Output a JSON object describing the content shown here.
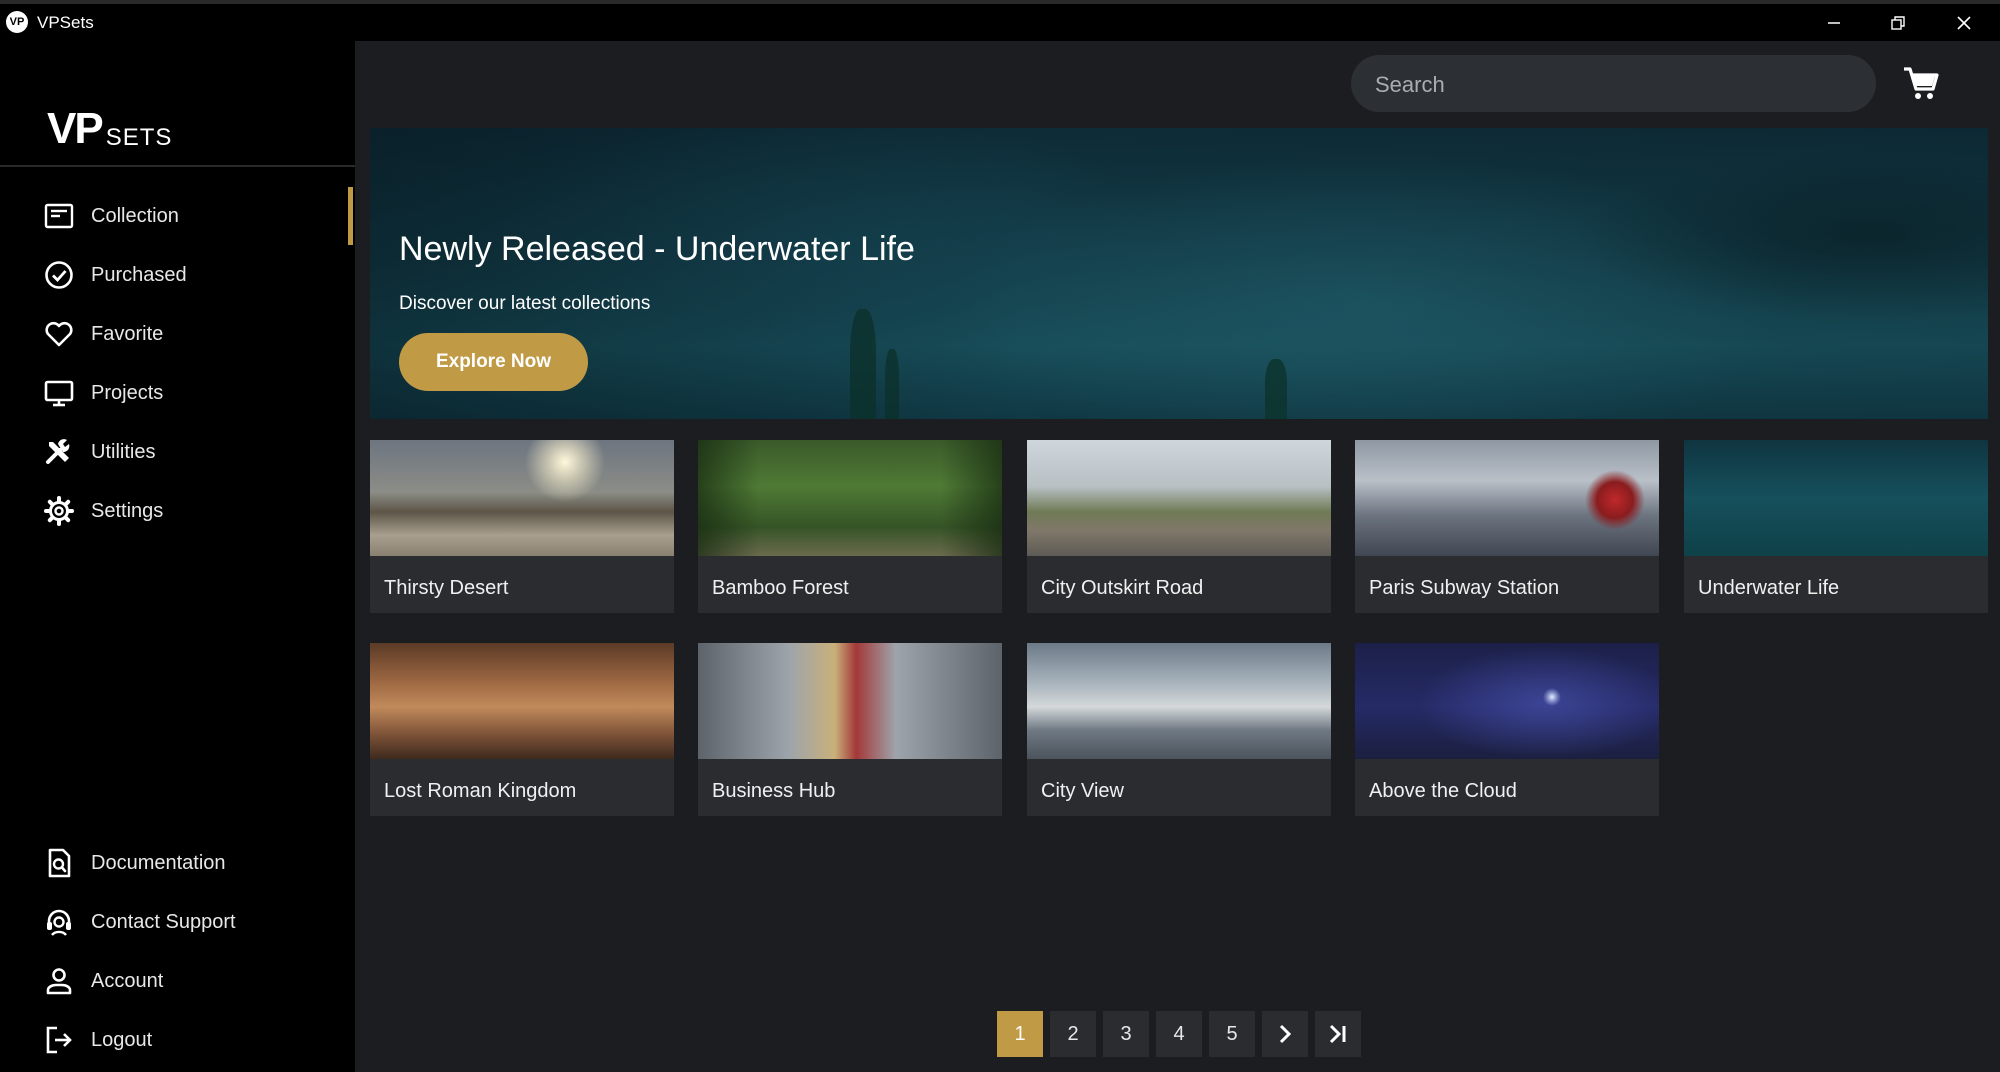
{
  "window": {
    "title": "VPSets",
    "app_icon": "VP",
    "controls": [
      "minimize-icon",
      "restore-icon",
      "close-icon"
    ]
  },
  "logo": {
    "primary": "VP",
    "secondary": "SETS"
  },
  "sidebar": {
    "top_items": [
      {
        "label": "Collection",
        "icon": "collection-icon",
        "active": true
      },
      {
        "label": "Purchased",
        "icon": "check-circle-icon"
      },
      {
        "label": "Favorite",
        "icon": "heart-icon"
      },
      {
        "label": "Projects",
        "icon": "monitor-icon"
      },
      {
        "label": "Utilities",
        "icon": "tools-icon"
      },
      {
        "label": "Settings",
        "icon": "gear-icon"
      }
    ],
    "bottom_items": [
      {
        "label": "Documentation",
        "icon": "document-search-icon"
      },
      {
        "label": "Contact Support",
        "icon": "headset-icon"
      },
      {
        "label": "Account",
        "icon": "user-icon"
      },
      {
        "label": "Logout",
        "icon": "logout-icon"
      }
    ]
  },
  "header": {
    "search": {
      "placeholder": "Search",
      "value": ""
    },
    "cart_icon": "cart-icon"
  },
  "banner": {
    "title": "Newly Released - Underwater Life",
    "subtitle": "Discover our latest collections",
    "button": "Explore Now"
  },
  "collections": [
    {
      "name": "Thirsty Desert"
    },
    {
      "name": "Bamboo Forest"
    },
    {
      "name": "City Outskirt Road"
    },
    {
      "name": "Paris Subway Station"
    },
    {
      "name": "Underwater Life"
    },
    {
      "name": "Lost Roman Kingdom"
    },
    {
      "name": "Business Hub"
    },
    {
      "name": "City View"
    },
    {
      "name": "Above the Cloud"
    }
  ],
  "pagination": {
    "pages": [
      "1",
      "2",
      "3",
      "4",
      "5"
    ],
    "current": "1",
    "next_icon": "chevron-right-icon",
    "last_icon": "last-page-icon"
  },
  "colors": {
    "accent": "#c19a45",
    "sidebar_bg": "#000000",
    "main_bg": "#1b1d20",
    "card_bg": "#2b2c2f"
  }
}
